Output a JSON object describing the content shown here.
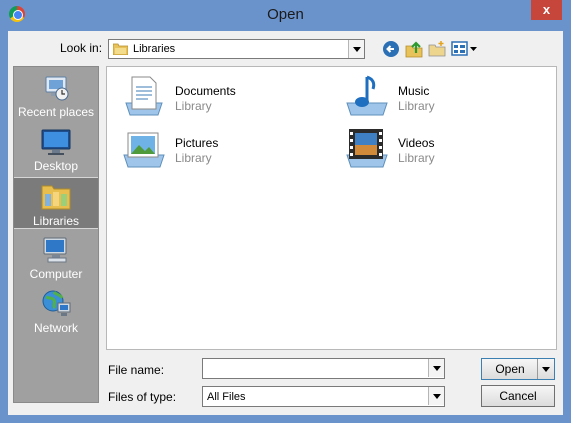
{
  "window": {
    "title": "Open",
    "close_label": "x"
  },
  "toolbar": {
    "look_in_label": "Look in:",
    "look_in_value": "Libraries",
    "icons": [
      "back-icon",
      "up-folder-icon",
      "new-folder-icon",
      "view-menu-icon"
    ]
  },
  "places": [
    {
      "label": "Recent places",
      "icon": "recent-places-icon"
    },
    {
      "label": "Desktop",
      "icon": "desktop-icon"
    },
    {
      "label": "Libraries",
      "icon": "libraries-icon",
      "selected": true
    },
    {
      "label": "Computer",
      "icon": "computer-icon"
    },
    {
      "label": "Network",
      "icon": "network-icon"
    }
  ],
  "files": [
    {
      "name": "Documents",
      "type": "Library",
      "icon": "documents-library-icon"
    },
    {
      "name": "Music",
      "type": "Library",
      "icon": "music-library-icon"
    },
    {
      "name": "Pictures",
      "type": "Library",
      "icon": "pictures-library-icon"
    },
    {
      "name": "Videos",
      "type": "Library",
      "icon": "videos-library-icon"
    }
  ],
  "bottom": {
    "file_name_label": "File name:",
    "file_name_value": "",
    "file_type_label": "Files of type:",
    "file_type_value": "All Files",
    "open_button": "Open",
    "cancel_button": "Cancel"
  },
  "colors": {
    "title_bar": "#6b93cb",
    "close_button": "#c7463b",
    "places_bar": "#a0a0a0"
  }
}
